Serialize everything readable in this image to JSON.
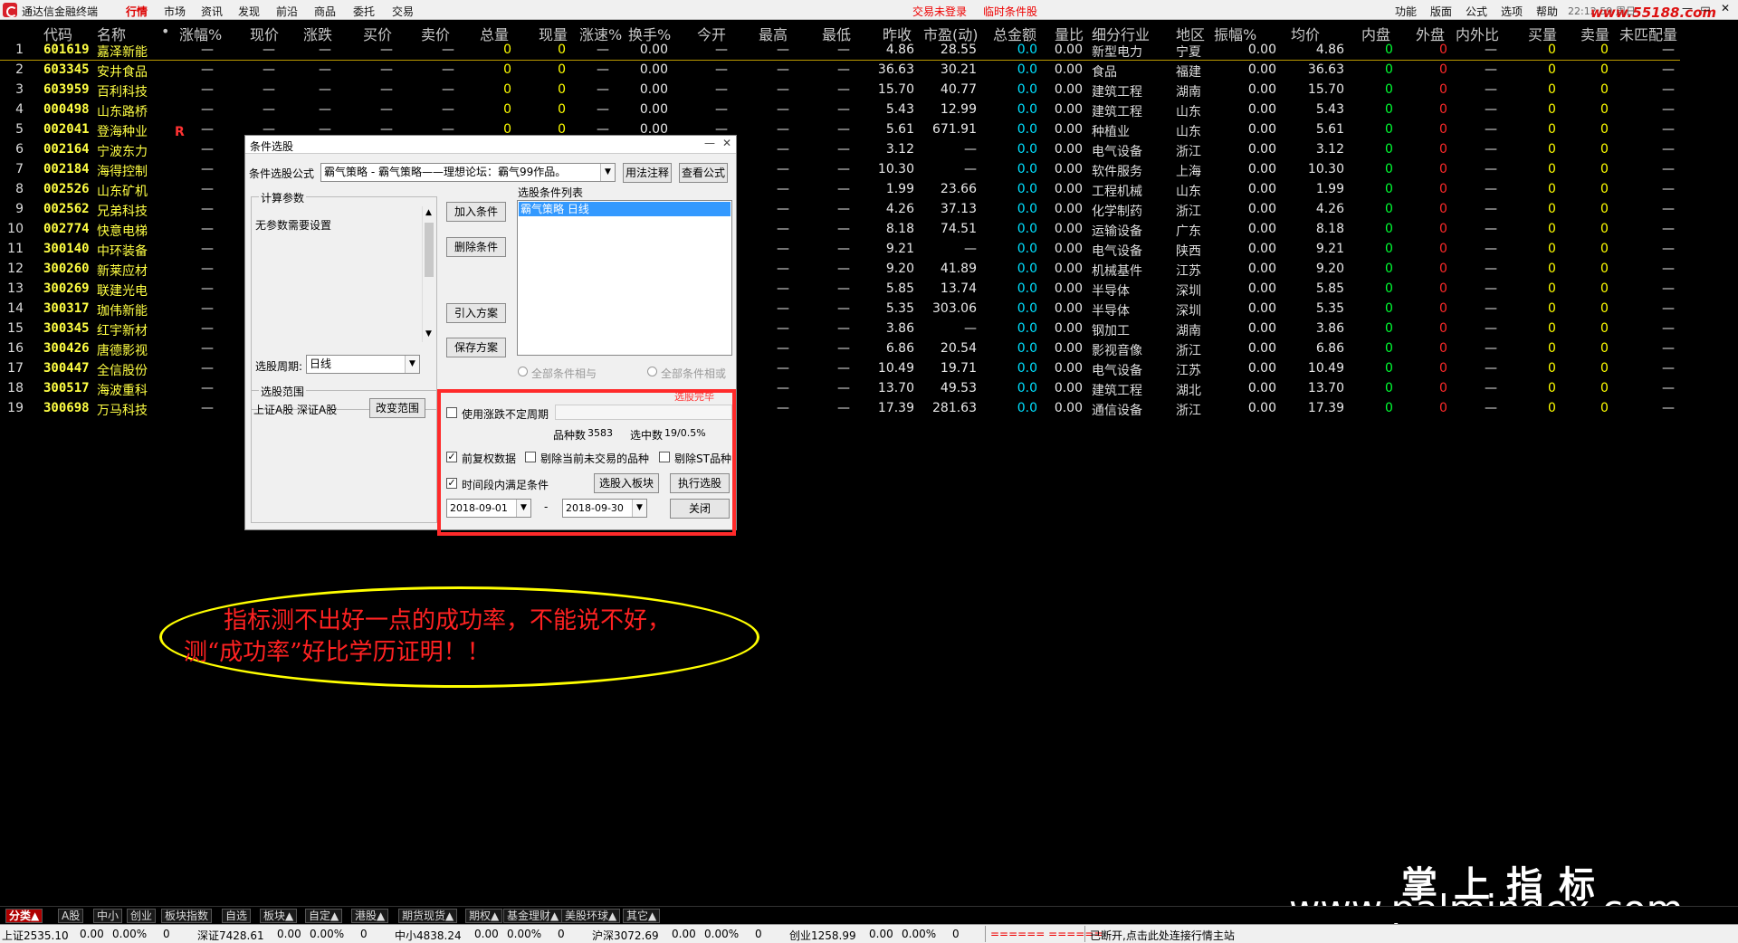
{
  "app": {
    "name": "通达信金融终端",
    "menu": [
      "行情",
      "市场",
      "资讯",
      "发现",
      "前沿",
      "商品",
      "委托",
      "交易"
    ],
    "active_menu": "行情",
    "status_red": [
      "交易未登录",
      "临时条件股"
    ],
    "right_menu": [
      "功能",
      "版面",
      "公式",
      "选项",
      "帮助"
    ],
    "clock": "22:12:59 周日",
    "watermark_top": "www.55188.com",
    "window_buttons": [
      "—",
      "▭",
      "✕"
    ]
  },
  "table": {
    "headers": [
      "代码",
      "名称",
      "•",
      "涨幅%",
      "现价",
      "涨跌",
      "买价",
      "卖价",
      "总量",
      "现量",
      "涨速%",
      "换手%",
      "今开",
      "最高",
      "最低",
      "昨收",
      "市盈(动)",
      "总金额",
      "量比",
      "细分行业",
      "地区",
      "振幅%",
      "均价",
      "内盘",
      "外盘",
      "内外比",
      "买量",
      "卖量",
      "未匹配量"
    ],
    "rows": [
      {
        "n": "1",
        "code": "601619",
        "name": "嘉泽新能",
        "prev": "4.86",
        "pe": "28.55",
        "amt": "0.0",
        "vr": "0.00",
        "industry": "新型电力",
        "region": "宁夏",
        "amp": "0.00",
        "avg": "4.86",
        "turnover": "0.00",
        "vol": "0",
        "cur": "0",
        "flag": ""
      },
      {
        "n": "2",
        "code": "603345",
        "name": "安井食品",
        "prev": "36.63",
        "pe": "30.21",
        "amt": "0.0",
        "vr": "0.00",
        "industry": "食品",
        "region": "福建",
        "amp": "0.00",
        "avg": "36.63",
        "turnover": "0.00",
        "vol": "0",
        "cur": "0",
        "flag": ""
      },
      {
        "n": "3",
        "code": "603959",
        "name": "百利科技",
        "prev": "15.70",
        "pe": "40.77",
        "amt": "0.0",
        "vr": "0.00",
        "industry": "建筑工程",
        "region": "湖南",
        "amp": "0.00",
        "avg": "15.70",
        "turnover": "0.00",
        "vol": "0",
        "cur": "0",
        "flag": ""
      },
      {
        "n": "4",
        "code": "000498",
        "name": "山东路桥",
        "prev": "5.43",
        "pe": "12.99",
        "amt": "0.0",
        "vr": "0.00",
        "industry": "建筑工程",
        "region": "山东",
        "amp": "0.00",
        "avg": "5.43",
        "turnover": "0.00",
        "vol": "0",
        "cur": "0",
        "flag": ""
      },
      {
        "n": "5",
        "code": "002041",
        "name": "登海种业",
        "prev": "5.61",
        "pe": "671.91",
        "amt": "0.0",
        "vr": "0.00",
        "industry": "种植业",
        "region": "山东",
        "amp": "0.00",
        "avg": "5.61",
        "turnover": "0.00",
        "vol": "0",
        "cur": "0",
        "flag": "R"
      },
      {
        "n": "6",
        "code": "002164",
        "name": "宁波东力",
        "prev": "3.12",
        "pe": "—",
        "amt": "0.0",
        "vr": "0.00",
        "industry": "电气设备",
        "region": "浙江",
        "amp": "0.00",
        "avg": "3.12",
        "turnover": "",
        "vol": "",
        "cur": "",
        "flag": ""
      },
      {
        "n": "7",
        "code": "002184",
        "name": "海得控制",
        "prev": "10.30",
        "pe": "—",
        "amt": "0.0",
        "vr": "0.00",
        "industry": "软件服务",
        "region": "上海",
        "amp": "0.00",
        "avg": "10.30",
        "turnover": "",
        "vol": "",
        "cur": "",
        "flag": ""
      },
      {
        "n": "8",
        "code": "002526",
        "name": "山东矿机",
        "prev": "1.99",
        "pe": "23.66",
        "amt": "0.0",
        "vr": "0.00",
        "industry": "工程机械",
        "region": "山东",
        "amp": "0.00",
        "avg": "1.99",
        "turnover": "",
        "vol": "",
        "cur": "",
        "flag": ""
      },
      {
        "n": "9",
        "code": "002562",
        "name": "兄弟科技",
        "prev": "4.26",
        "pe": "37.13",
        "amt": "0.0",
        "vr": "0.00",
        "industry": "化学制药",
        "region": "浙江",
        "amp": "0.00",
        "avg": "4.26",
        "turnover": "",
        "vol": "",
        "cur": "",
        "flag": ""
      },
      {
        "n": "10",
        "code": "002774",
        "name": "快意电梯",
        "prev": "8.18",
        "pe": "74.51",
        "amt": "0.0",
        "vr": "0.00",
        "industry": "运输设备",
        "region": "广东",
        "amp": "0.00",
        "avg": "8.18",
        "turnover": "",
        "vol": "",
        "cur": "",
        "flag": ""
      },
      {
        "n": "11",
        "code": "300140",
        "name": "中环装备",
        "prev": "9.21",
        "pe": "—",
        "amt": "0.0",
        "vr": "0.00",
        "industry": "电气设备",
        "region": "陕西",
        "amp": "0.00",
        "avg": "9.21",
        "turnover": "",
        "vol": "",
        "cur": "",
        "flag": ""
      },
      {
        "n": "12",
        "code": "300260",
        "name": "新莱应材",
        "prev": "9.20",
        "pe": "41.89",
        "amt": "0.0",
        "vr": "0.00",
        "industry": "机械基件",
        "region": "江苏",
        "amp": "0.00",
        "avg": "9.20",
        "turnover": "",
        "vol": "",
        "cur": "",
        "flag": ""
      },
      {
        "n": "13",
        "code": "300269",
        "name": "联建光电",
        "prev": "5.85",
        "pe": "13.74",
        "amt": "0.0",
        "vr": "0.00",
        "industry": "半导体",
        "region": "深圳",
        "amp": "0.00",
        "avg": "5.85",
        "turnover": "",
        "vol": "",
        "cur": "",
        "flag": ""
      },
      {
        "n": "14",
        "code": "300317",
        "name": "珈伟新能",
        "prev": "5.35",
        "pe": "303.06",
        "amt": "0.0",
        "vr": "0.00",
        "industry": "半导体",
        "region": "深圳",
        "amp": "0.00",
        "avg": "5.35",
        "turnover": "",
        "vol": "",
        "cur": "",
        "flag": ""
      },
      {
        "n": "15",
        "code": "300345",
        "name": "红宇新材",
        "prev": "3.86",
        "pe": "—",
        "amt": "0.0",
        "vr": "0.00",
        "industry": "钢加工",
        "region": "湖南",
        "amp": "0.00",
        "avg": "3.86",
        "turnover": "",
        "vol": "",
        "cur": "",
        "flag": ""
      },
      {
        "n": "16",
        "code": "300426",
        "name": "唐德影视",
        "prev": "6.86",
        "pe": "20.54",
        "amt": "0.0",
        "vr": "0.00",
        "industry": "影视音像",
        "region": "浙江",
        "amp": "0.00",
        "avg": "6.86",
        "turnover": "",
        "vol": "",
        "cur": "",
        "flag": ""
      },
      {
        "n": "17",
        "code": "300447",
        "name": "全信股份",
        "prev": "10.49",
        "pe": "19.71",
        "amt": "0.0",
        "vr": "0.00",
        "industry": "电气设备",
        "region": "江苏",
        "amp": "0.00",
        "avg": "10.49",
        "turnover": "",
        "vol": "",
        "cur": "",
        "flag": ""
      },
      {
        "n": "18",
        "code": "300517",
        "name": "海波重科",
        "prev": "13.70",
        "pe": "49.53",
        "amt": "0.0",
        "vr": "0.00",
        "industry": "建筑工程",
        "region": "湖北",
        "amp": "0.00",
        "avg": "13.70",
        "turnover": "",
        "vol": "",
        "cur": "",
        "flag": ""
      },
      {
        "n": "19",
        "code": "300698",
        "name": "万马科技",
        "prev": "17.39",
        "pe": "281.63",
        "amt": "0.0",
        "vr": "0.00",
        "industry": "通信设备",
        "region": "浙江",
        "amp": "0.00",
        "avg": "17.39",
        "turnover": "",
        "vol": "",
        "cur": "",
        "flag": ""
      }
    ],
    "dash": "—",
    "inner": "0",
    "outer": "0",
    "buyvol": "0",
    "sellvol": "0"
  },
  "dialog": {
    "title": "条件选股",
    "formula_label": "条件选股公式",
    "formula_value": "霸气策略     - 霸气策略——理想论坛：霸气99作品。",
    "usage_btn": "用法注释",
    "view_btn": "查看公式",
    "params_group": "计算参数",
    "params_text": "无参数需要设置",
    "add_btn": "加入条件",
    "delete_btn": "删除条件",
    "import_btn": "引入方案",
    "save_btn": "保存方案",
    "list_label": "选股条件列表",
    "list_item": "霸气策略  日线",
    "radio_and": "全部条件相与",
    "radio_or": "全部条件相或",
    "period_label": "选股周期:",
    "period_value": "日线",
    "range_group": "选股范围",
    "range_text": "上证A股 深证A股",
    "change_range_btn": "改变范围",
    "done_text": "选股完毕",
    "use_variable_period": "使用涨跌不定周期",
    "count_label": "品种数",
    "count_value": "3583",
    "selected_label": "选中数",
    "selected_value": "19/0.5%",
    "pre_adjust": "前复权数据",
    "exclude_untraded": "剔除当前未交易的品种",
    "exclude_st": "剔除ST品种",
    "time_range": "时间段内满足条件",
    "to_block_btn": "选股入板块",
    "exec_btn": "执行选股",
    "close_btn": "关闭",
    "date_from": "2018-09-01",
    "date_to": "2018-09-30",
    "date_sep": "-"
  },
  "annotation": {
    "line1": "指标测不出好一点的成功率，不能说不好，",
    "line2": "测“成功率”好比学历证明！！"
  },
  "watermark": {
    "cn": "掌上指标",
    "url": "www.palmindex.com"
  },
  "tabs": [
    "分类▲",
    "A股",
    "中小",
    "创业",
    "板块指数",
    "自选",
    "板块▲",
    "自定▲",
    "港股▲",
    "期货现货▲",
    "期权▲",
    "基金理财▲",
    "美股环球▲",
    "其它▲"
  ],
  "statusbar": {
    "sh": "上证2535.10",
    "sh_chg": "0.00",
    "sh_pct": "0.00%",
    "sh_vol": "0",
    "sz": "深证7428.61",
    "sz_chg": "0.00",
    "sz_pct": "0.00%",
    "sz_vol": "0",
    "zx": "中小4838.24",
    "zx_chg": "0.00",
    "zx_pct": "0.00%",
    "zx_vol": "0",
    "hs": "沪深3072.69",
    "hs_chg": "0.00",
    "hs_pct": "0.00%",
    "hs_vol": "0",
    "cy": "创业1258.99",
    "cy_chg": "0.00",
    "cy_pct": "0.00%",
    "cy_vol": "0",
    "eq": "====== ======",
    "msg": "已断开,点击此处连接行情主站"
  }
}
